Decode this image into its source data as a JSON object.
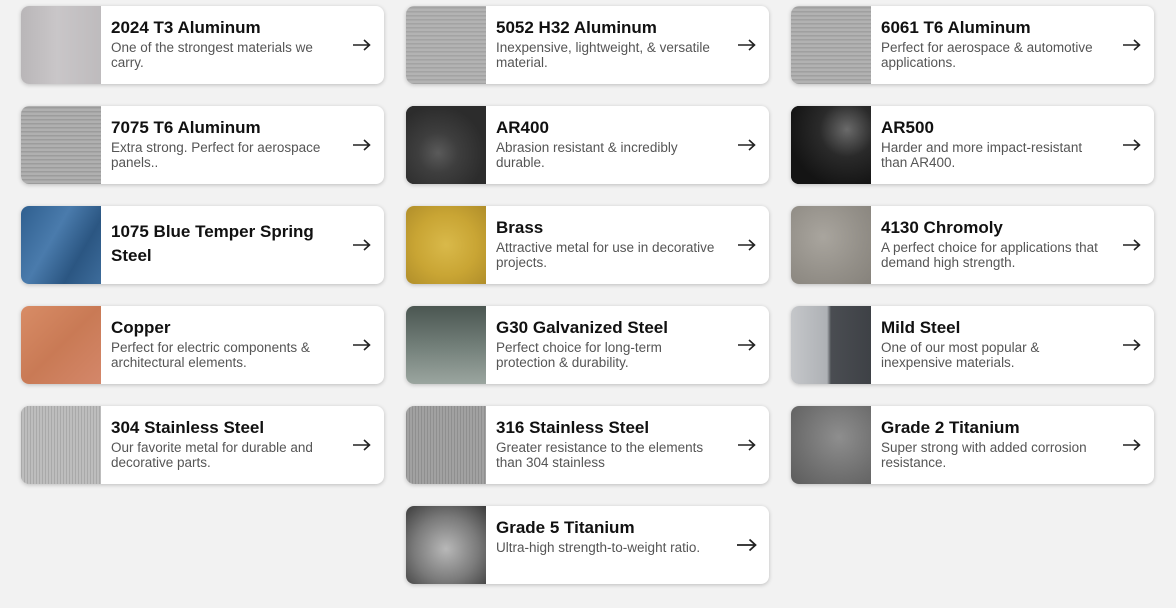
{
  "materials": [
    {
      "title": "2024 T3 Aluminum",
      "desc": "One of the strongest materials we carry."
    },
    {
      "title": "5052 H32 Aluminum",
      "desc": "Inexpensive, lightweight, & versatile material."
    },
    {
      "title": "6061 T6 Aluminum",
      "desc": "Perfect for aerospace & automotive applications."
    },
    {
      "title": "7075 T6 Aluminum",
      "desc": "Extra strong. Perfect for aerospace panels.."
    },
    {
      "title": "AR400",
      "desc": "Abrasion resistant & incredibly durable."
    },
    {
      "title": "AR500",
      "desc": "Harder and more impact-resistant than AR400."
    },
    {
      "title": "1075 Blue Temper Spring Steel",
      "desc": ""
    },
    {
      "title": "Brass",
      "desc": "Attractive metal for use in decorative projects."
    },
    {
      "title": "4130 Chromoly",
      "desc": "A perfect choice for applications that demand high strength."
    },
    {
      "title": "Copper",
      "desc": "Perfect for electric components & architectural elements."
    },
    {
      "title": "G30 Galvanized Steel",
      "desc": "Perfect choice for long-term protection & durability."
    },
    {
      "title": "Mild Steel",
      "desc": "One of our most popular & inexpensive materials."
    },
    {
      "title": "304 Stainless Steel",
      "desc": "Our favorite metal for durable and decorative parts."
    },
    {
      "title": "316 Stainless Steel",
      "desc": "Greater resistance to the elements than 304 stainless"
    },
    {
      "title": "Grade 2 Titanium",
      "desc": "Super strong with added corrosion resistance."
    },
    {
      "title": "Grade 5 Titanium",
      "desc": "Ultra-high strength-to-weight ratio."
    }
  ],
  "icons": {
    "arrow": "arrow-right-icon"
  }
}
